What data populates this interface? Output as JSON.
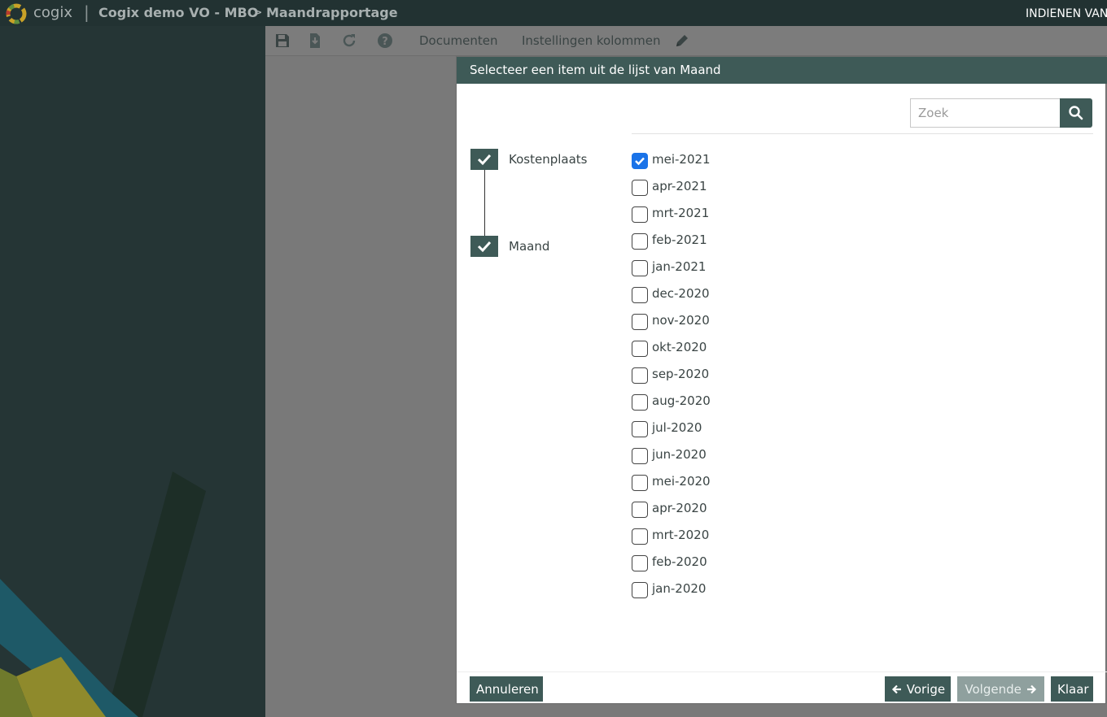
{
  "topbar": {
    "brand": "cogix",
    "separator": "|",
    "crumb_project": "Cogix demo VO - MBO",
    "crumb_separator": ">",
    "crumb_page": "Maandrapportage",
    "right_text": "INDIENEN VAN"
  },
  "toolbar": {
    "icons": [
      "save-icon",
      "download-icon",
      "refresh-icon",
      "help-icon",
      "pencil-icon"
    ],
    "documents_label": "Documenten",
    "columns_label": "Instellingen kolommen"
  },
  "modal": {
    "title": "Selecteer een item uit de lijst van Maand",
    "search_placeholder": "Zoek",
    "levels": [
      {
        "label": "Kostenplaats",
        "checked": true
      },
      {
        "label": "Maand",
        "checked": true
      }
    ],
    "months": [
      {
        "label": "mei-2021",
        "checked": true
      },
      {
        "label": "apr-2021",
        "checked": false
      },
      {
        "label": "mrt-2021",
        "checked": false
      },
      {
        "label": "feb-2021",
        "checked": false
      },
      {
        "label": "jan-2021",
        "checked": false
      },
      {
        "label": "dec-2020",
        "checked": false
      },
      {
        "label": "nov-2020",
        "checked": false
      },
      {
        "label": "okt-2020",
        "checked": false
      },
      {
        "label": "sep-2020",
        "checked": false
      },
      {
        "label": "aug-2020",
        "checked": false
      },
      {
        "label": "jul-2020",
        "checked": false
      },
      {
        "label": "jun-2020",
        "checked": false
      },
      {
        "label": "mei-2020",
        "checked": false
      },
      {
        "label": "apr-2020",
        "checked": false
      },
      {
        "label": "mrt-2020",
        "checked": false
      },
      {
        "label": "feb-2020",
        "checked": false
      },
      {
        "label": "jan-2020",
        "checked": false
      }
    ],
    "buttons": {
      "cancel": "Annuleren",
      "previous": "Vorige",
      "next": "Volgende",
      "done": "Klaar"
    }
  },
  "colors": {
    "accent": "#3e5a57",
    "checkbox_checked": "#1a73e8",
    "topbar": "#223232"
  }
}
